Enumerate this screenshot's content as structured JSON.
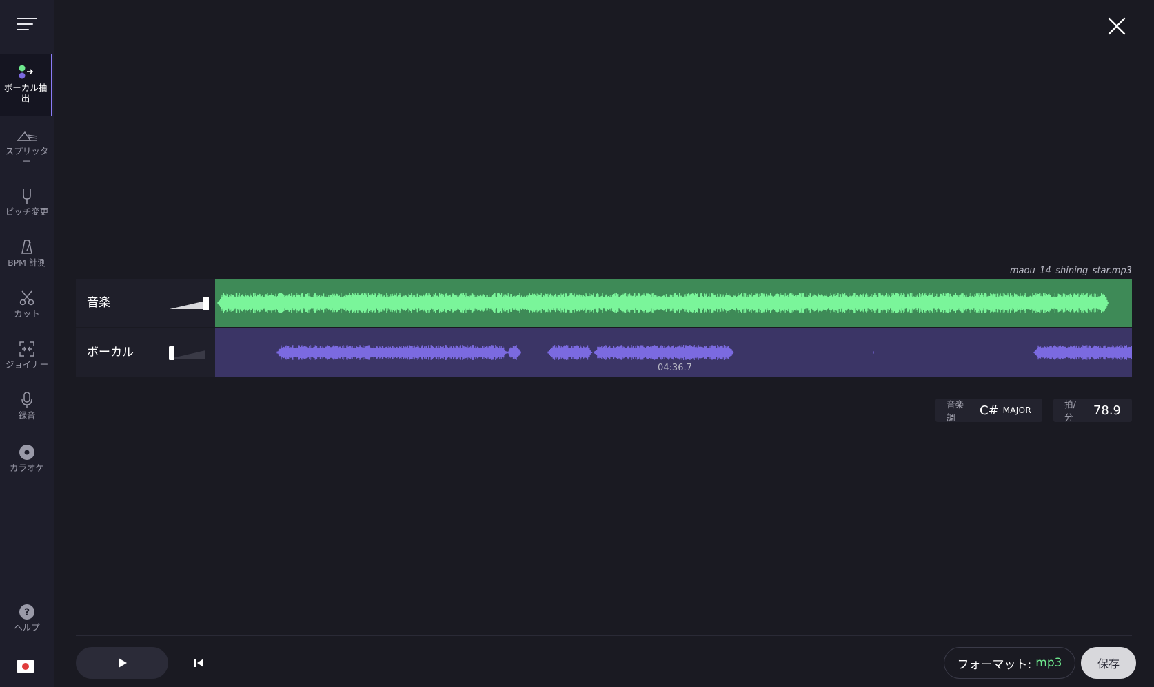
{
  "sidebar": {
    "items": [
      {
        "label": "ボーカル抽出",
        "icon": "vocal-extract-icon",
        "active": true
      },
      {
        "label": "スプリッター",
        "icon": "splitter-icon"
      },
      {
        "label": "ピッチ変更",
        "icon": "tuning-fork-icon"
      },
      {
        "label": "BPM 計測",
        "icon": "metronome-icon"
      },
      {
        "label": "カット",
        "icon": "scissors-icon"
      },
      {
        "label": "ジョイナー",
        "icon": "joiner-icon"
      },
      {
        "label": "録音",
        "icon": "microphone-icon"
      },
      {
        "label": "カラオケ",
        "icon": "disc-icon"
      }
    ],
    "help_label": "ヘルプ",
    "language_flag": "japan-flag-icon"
  },
  "file": {
    "name": "maou_14_shining_star.mp3"
  },
  "tracks": [
    {
      "name": "音楽",
      "volume": 1.0,
      "color": "#7af59a",
      "bg": "#3e8a57"
    },
    {
      "name": "ボーカル",
      "volume": 0.0,
      "color": "#7b6ae0",
      "bg": "#3b3566"
    }
  ],
  "duration": "04:36.7",
  "key": {
    "label": "音楽調",
    "note": "C#",
    "mode": "MAJOR"
  },
  "bpm": {
    "label": "拍/分",
    "value": "78.9"
  },
  "bottom": {
    "format_label": "フォーマット:",
    "format_value": "mp3",
    "save_label": "保存"
  }
}
